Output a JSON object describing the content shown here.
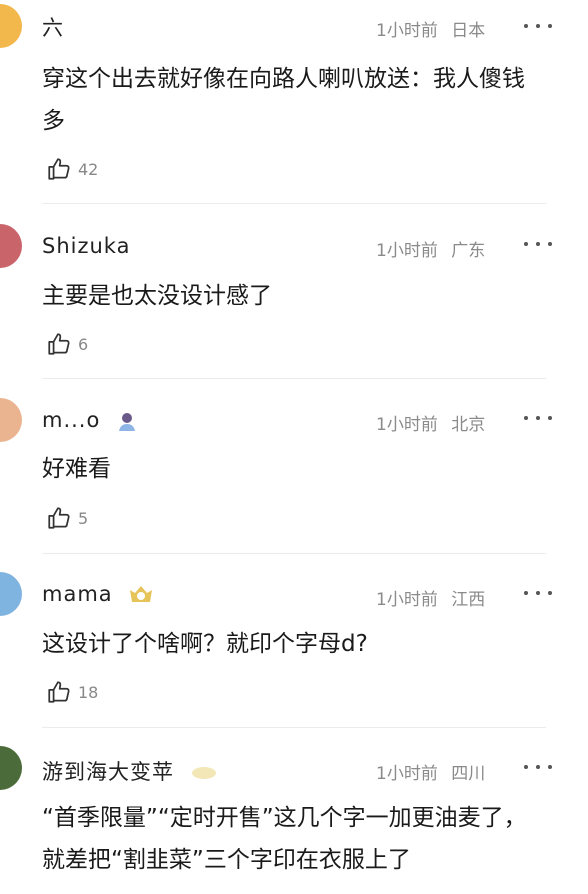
{
  "comments": [
    {
      "name": "六",
      "time": "1小时前",
      "location": "日本",
      "text": "穿这个出去就好像在向路人喇叭放送：我人傻钱多",
      "likes": "42",
      "avatar_color": "#f2b84b"
    },
    {
      "name": "Shizuka",
      "time": "1小时前",
      "location": "广东",
      "text": "主要是也太没设计感了",
      "likes": "6",
      "avatar_color": "#c9646b"
    },
    {
      "name": "m...o",
      "time": "1小时前",
      "location": "北京",
      "text": "好难看",
      "likes": "5",
      "avatar_color": "#e9b48f"
    },
    {
      "name": "mama",
      "time": "1小时前",
      "location": "江西",
      "text": "这设计了个啥啊？就印个字母d?",
      "likes": "18",
      "avatar_color": "#7fb3e0"
    },
    {
      "name": "游到海大变苹",
      "time": "1小时前",
      "location": "四川",
      "text": "“首季限量”“定时开售”这几个字一加更油麦了，就差把“割韭菜”三个字印在衣服上了",
      "likes": "",
      "avatar_color": "#4b6b3a"
    }
  ],
  "icons": {
    "like": "thumbs-up-icon",
    "more": "more-dots-icon"
  }
}
